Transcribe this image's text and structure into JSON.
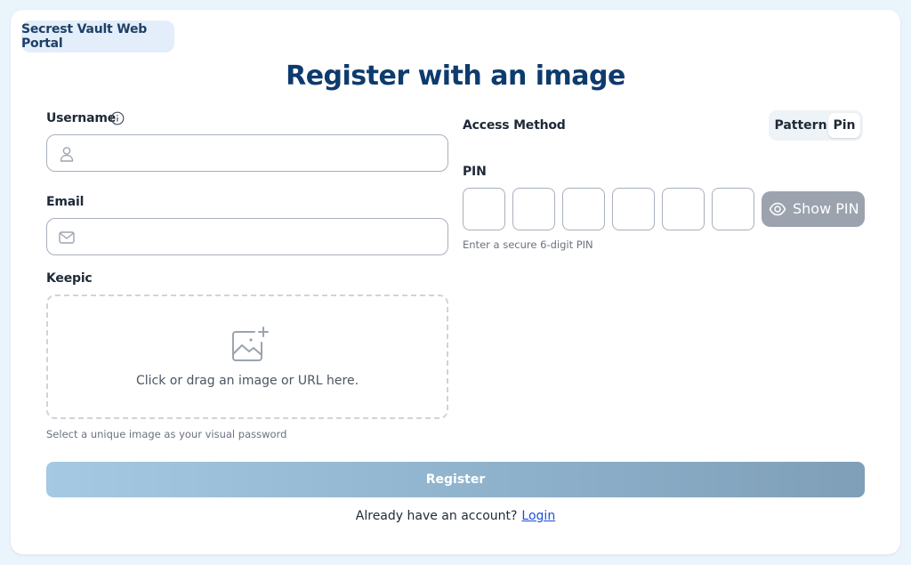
{
  "header": {
    "portal_name": "Secrest Vault Web Portal",
    "title": "Register with an image"
  },
  "form": {
    "username": {
      "label": "Username",
      "value": "",
      "placeholder": ""
    },
    "email": {
      "label": "Email",
      "value": "",
      "placeholder": ""
    },
    "keepic": {
      "label": "Keepic",
      "drop_text": "Click or drag an image or URL here.",
      "hint": "Select a unique image as your visual password"
    }
  },
  "access": {
    "label": "Access Method",
    "options": [
      "Pattern",
      "Pin"
    ],
    "selected": "Pin",
    "pin_label": "PIN",
    "pin_digits": [
      "",
      "",
      "",
      "",
      "",
      ""
    ],
    "pin_hint": "Enter a secure 6-digit PIN",
    "show_pin_label": "Show PIN"
  },
  "actions": {
    "register_label": "Register",
    "login_prompt": "Already have an account?",
    "login_link": "Login"
  },
  "colors": {
    "title": "#0e3b6e",
    "background": "#eaf4fb",
    "link": "#1d4ed8",
    "show_pin_bg": "#9ca3af"
  }
}
